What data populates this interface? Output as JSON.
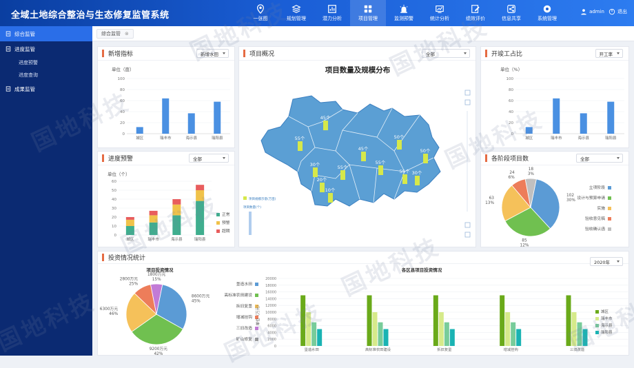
{
  "app": {
    "title": "全域土地综合整治与生态修复监管系统"
  },
  "nav": [
    {
      "label": "一张图",
      "icon": "map-pin-icon"
    },
    {
      "label": "规划管理",
      "icon": "layers-icon"
    },
    {
      "label": "潜力分析",
      "icon": "analysis-icon"
    },
    {
      "label": "项目管理",
      "icon": "grid-icon"
    },
    {
      "label": "监测预警",
      "icon": "alarm-icon"
    },
    {
      "label": "统计分析",
      "icon": "chart-icon"
    },
    {
      "label": "绩效评价",
      "icon": "edit-icon"
    },
    {
      "label": "信息共享",
      "icon": "share-icon"
    },
    {
      "label": "系统管理",
      "icon": "gear-icon"
    }
  ],
  "user": {
    "name": "admin",
    "logout": "退出"
  },
  "sidebar": {
    "items": [
      {
        "label": "综合监管",
        "active": true
      },
      {
        "label": "进度监管",
        "subs": [
          "进度预警",
          "进度查询"
        ]
      },
      {
        "label": "成果监管"
      }
    ]
  },
  "tabs": [
    {
      "label": "综合监管"
    }
  ],
  "watermark": "国地科技",
  "panels": {
    "new_indicators": {
      "title": "新增指标",
      "select": "新增水田"
    },
    "project_overview": {
      "title": "项目概况",
      "select": "全部",
      "map_title": "项目数量及规模分布",
      "legend1": "项目规模示意(万亩)",
      "legend2": "项目数量(个)"
    },
    "start_ratio": {
      "title": "开竣工占比",
      "select": "开工率"
    },
    "progress_warning": {
      "title": "进度预警",
      "select": "全部"
    },
    "stage_projects": {
      "title": "各阶段项目数",
      "select": "全部"
    },
    "investment": {
      "title": "投资情况统计",
      "select": "2020年"
    }
  },
  "chart_data": [
    {
      "id": "new_indicators",
      "type": "bar",
      "ylabel": "单位（亩）",
      "categories": [
        "城区",
        "瑞丰市",
        "海示县",
        "瑞阳县"
      ],
      "values": [
        12,
        64,
        37,
        58
      ],
      "ylim": [
        0,
        100
      ],
      "yticks": [
        0,
        20,
        40,
        60,
        80,
        100
      ]
    },
    {
      "id": "start_ratio",
      "type": "bar",
      "ylabel": "单位（%）",
      "categories": [
        "城区",
        "瑞丰市",
        "海示县",
        "瑞阳县"
      ],
      "values": [
        12,
        64,
        37,
        58
      ],
      "ylim": [
        0,
        100
      ],
      "yticks": [
        0,
        20,
        40,
        60,
        80,
        100
      ]
    },
    {
      "id": "progress_warning",
      "type": "bar",
      "stacked": true,
      "ylabel": "单位（个）",
      "categories": [
        "城区",
        "瑞丰市",
        "海示县",
        "瑞阳县"
      ],
      "series": [
        {
          "name": "正常",
          "color": "#3fae8e",
          "values": [
            10,
            14,
            22,
            38
          ]
        },
        {
          "name": "预警",
          "color": "#f0c24a",
          "values": [
            7,
            8,
            12,
            12
          ]
        },
        {
          "name": "超期",
          "color": "#e85d5d",
          "values": [
            3,
            5,
            6,
            6
          ]
        }
      ],
      "ylim": [
        0,
        60
      ],
      "yticks": [
        0,
        10,
        20,
        30,
        40,
        50,
        60
      ]
    },
    {
      "id": "stage_projects",
      "type": "pie",
      "slices": [
        {
          "name": "立项阶段",
          "value": 102,
          "label": "102\n30%",
          "color": "#5b9bd5"
        },
        {
          "name": "设计与预算申请",
          "value": 85,
          "label": "85\n12%",
          "color": "#70c050"
        },
        {
          "name": "实施",
          "value": 63,
          "label": "63\n13%",
          "color": "#f5c15a"
        },
        {
          "name": "验收意见稿",
          "value": 24,
          "label": "24\n6%",
          "color": "#ed7d5a"
        },
        {
          "name": "验收确认函",
          "value": 18,
          "label": "18\n3%",
          "color": "#c0c0c0"
        }
      ]
    },
    {
      "id": "project_investment",
      "type": "pie",
      "title": "项目投资情况",
      "slices": [
        {
          "name": "垦造水田",
          "value": 8600,
          "label": "8600万元\n45%",
          "color": "#5b9bd5"
        },
        {
          "name": "高标准农田建设",
          "value": 9200,
          "label": "9200万元\n42%",
          "color": "#70c050"
        },
        {
          "name": "拆旧复垦",
          "value": 6300,
          "label": "6300万元\n46%",
          "color": "#f5c15a"
        },
        {
          "name": "增减挂钩",
          "value": 2800,
          "label": "2800万元\n25%",
          "color": "#ed7d5a"
        },
        {
          "name": "三旧改造",
          "value": 1800,
          "label": "1800万元\n15%",
          "color": "#c27bd6"
        },
        {
          "name": "矿山修复",
          "value": 0,
          "label": "",
          "color": "#9a9a9a"
        }
      ]
    },
    {
      "id": "region_investment",
      "type": "bar",
      "title": "各区县项目投资情况",
      "ylabel": "单位（万元）",
      "categories": [
        "垦造水田",
        "高标准农田建设",
        "拆旧复垦",
        "增减挂钩",
        "三旧改造",
        "矿山修复"
      ],
      "series": [
        {
          "name": "城区",
          "color": "#6aaa1a",
          "values": [
            15000,
            15000,
            15000,
            15000,
            15000,
            16000
          ]
        },
        {
          "name": "瑞丰市",
          "color": "#d6ea8a",
          "values": [
            10000,
            10000,
            10000,
            10000,
            10000,
            10000
          ]
        },
        {
          "name": "海示县",
          "color": "#78cc9a",
          "values": [
            7000,
            7000,
            7000,
            7000,
            7000,
            8000
          ]
        },
        {
          "name": "瑞阳县",
          "color": "#1ab3b3",
          "values": [
            5000,
            5000,
            5000,
            5000,
            5000,
            5000
          ]
        }
      ],
      "ylim": [
        0,
        20000
      ],
      "yticks": [
        0,
        2000,
        4000,
        6000,
        8000,
        10000,
        12000,
        14000,
        16000,
        18000,
        20000
      ]
    }
  ],
  "map": {
    "labels": [
      "45个",
      "55个",
      "45个",
      "50个",
      "50个",
      "55个",
      "30个",
      "55个",
      "55个",
      "30个",
      "20个",
      "10个"
    ],
    "colors": {
      "region": "#5b9fd4",
      "border": "#ffffff",
      "bar": "#d6e84a"
    }
  }
}
